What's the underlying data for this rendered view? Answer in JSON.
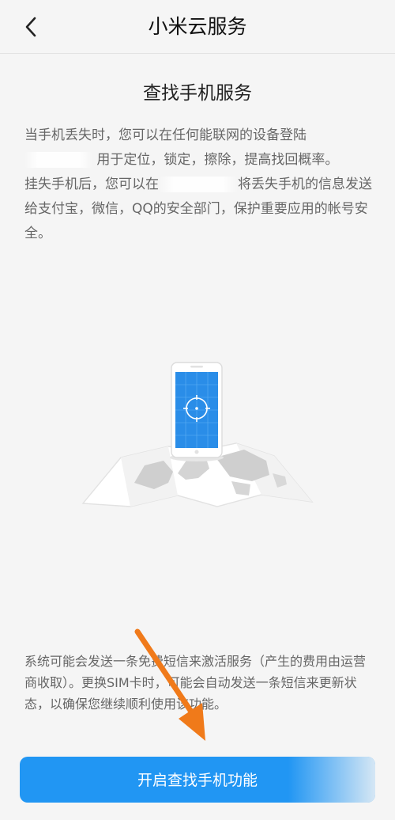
{
  "header": {
    "title": "小米云服务"
  },
  "main": {
    "section_title": "查找手机服务",
    "desc_line1": "当手机丢失时，您可以在任何能联网的设备登陆",
    "desc_line2": "用于定位，锁定，擦除，提高找回概率。",
    "desc_line3_a": "挂失手机后，您可以在",
    "desc_line3_b": "将丢失手机的信息发送给支付宝，微信，QQ的安全部门，保护重要应用的帐号安全。",
    "note": "系统可能会发送一条免费短信来激活服务（产生的费用由运营商收取）。更换SIM卡时，可能会自动发送一条短信来更新状态，以确保您继续顺利使用该功能。",
    "button_label": "开启查找手机功能"
  },
  "colors": {
    "accent": "#2196f3",
    "background": "#f5f5f5",
    "annotation_arrow": "#f07a1a"
  },
  "icons": {
    "back": "chevron-left-icon",
    "illustration": "phone-on-map-illustration",
    "annotation": "orange-arrow-annotation"
  }
}
